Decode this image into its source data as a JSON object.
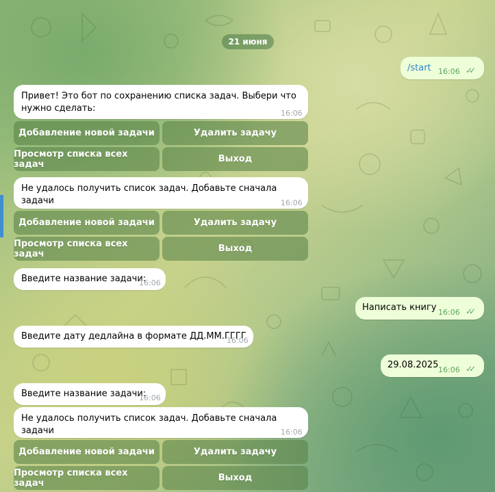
{
  "chat": {
    "date_label": "21 июня",
    "messages": [
      {
        "direction": "out",
        "text": "/start",
        "time": "16:06",
        "status": "read"
      },
      {
        "direction": "in",
        "text": "Привет! Это бот по сохранению списка задач. Выбери что нужно сделать:",
        "time": "16:06"
      },
      {
        "direction": "in",
        "text": "Не удалось получить список задач. Добавьте сначала задачи",
        "time": "16:06"
      },
      {
        "direction": "in",
        "text": "Введите название задачи:",
        "time": "16:06"
      },
      {
        "direction": "out",
        "text": "Написать книгу",
        "time": "16:06",
        "status": "read"
      },
      {
        "direction": "in",
        "text": "Введите дату дедлайна в формате ДД.ММ.ГГГГ",
        "time": "16:06"
      },
      {
        "direction": "out",
        "text": "29.08.2025",
        "time": "16:06",
        "status": "read"
      },
      {
        "direction": "in",
        "text": "Введите название задачи:",
        "time": "16:06"
      },
      {
        "direction": "in",
        "text": "Не удалось получить список задач. Добавьте сначала задачи",
        "time": "16:06"
      }
    ],
    "keyboard": {
      "add_task": "Добавление новой задачи",
      "delete_task": "Удалить задачу",
      "view_tasks": "Просмотр списка всех задач",
      "exit": "Выход"
    }
  },
  "colors": {
    "incoming_bubble": "#ffffff",
    "outgoing_bubble": "#eefed8",
    "time_outgoing": "#5ca55e",
    "time_incoming": "#a0a8ad",
    "keyboard_button": "#5a8349",
    "command_link": "#2c84c9"
  },
  "icons": {
    "read_status": "double-check-icon"
  }
}
